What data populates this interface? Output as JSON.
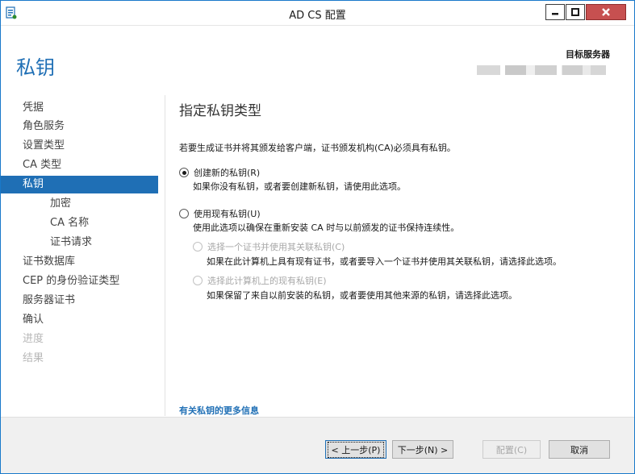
{
  "window": {
    "title": "AD CS 配置",
    "minimize_glyph": "▁",
    "maximize_glyph": "□",
    "close_glyph": "X"
  },
  "header": {
    "page_title": "私钥",
    "target_server_label": "目标服务器"
  },
  "sidebar": {
    "items": [
      {
        "label": "凭据",
        "state": "normal"
      },
      {
        "label": "角色服务",
        "state": "normal"
      },
      {
        "label": "设置类型",
        "state": "normal"
      },
      {
        "label": "CA 类型",
        "state": "normal"
      },
      {
        "label": "私钥",
        "state": "active"
      },
      {
        "label": "加密",
        "state": "sub"
      },
      {
        "label": "CA 名称",
        "state": "sub"
      },
      {
        "label": "证书请求",
        "state": "sub"
      },
      {
        "label": "证书数据库",
        "state": "normal"
      },
      {
        "label": "CEP 的身份验证类型",
        "state": "normal"
      },
      {
        "label": "服务器证书",
        "state": "normal"
      },
      {
        "label": "确认",
        "state": "normal"
      },
      {
        "label": "进度",
        "state": "disabled"
      },
      {
        "label": "结果",
        "state": "disabled"
      }
    ]
  },
  "content": {
    "heading": "指定私钥类型",
    "intro": "若要生成证书并将其颁发给客户端，证书颁发机构(CA)必须具有私钥。",
    "option_new": {
      "label": "创建新的私钥(R)",
      "selected": true,
      "description": "如果你没有私钥，或者要创建新私钥，请使用此选项。"
    },
    "option_existing": {
      "label": "使用现有私钥(U)",
      "selected": false,
      "description": "使用此选项以确保在重新安装 CA 时与以前颁发的证书保持连续性。",
      "suboptions": [
        {
          "label": "选择一个证书并使用其关联私钥(C)",
          "selected": false,
          "enabled": false,
          "description": "如果在此计算机上具有现有证书，或者要导入一个证书并使用其关联私钥，请选择此选项。"
        },
        {
          "label": "选择此计算机上的现有私钥(E)",
          "selected": false,
          "enabled": false,
          "description": "如果保留了来自以前安装的私钥，或者要使用其他来源的私钥，请选择此选项。"
        }
      ]
    },
    "more_info_link": "有关私钥的更多信息"
  },
  "footer": {
    "back_button": "< 上一步(P)",
    "next_button": "下一步(N) >",
    "configure_button": "配置(C)",
    "cancel_button": "取消"
  },
  "colors": {
    "accent": "#1f6fb5",
    "close_button": "#c75050",
    "footer_bg": "#f0f0f0"
  }
}
